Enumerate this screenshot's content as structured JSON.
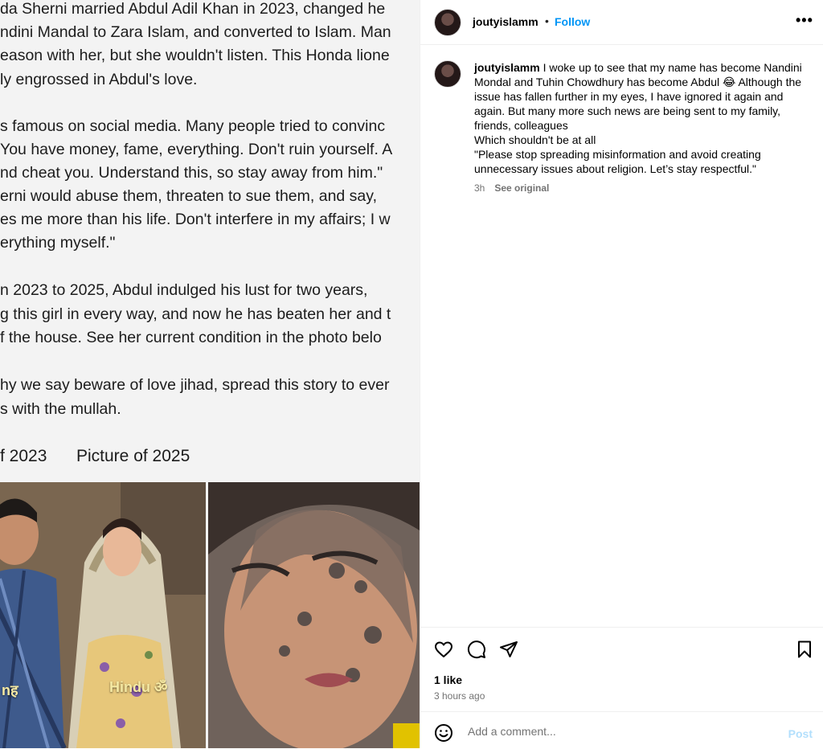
{
  "media": {
    "text_lines": [
      "da Sherni married Abdul Adil Khan in 2023, changed he",
      "ndini Mandal to Zara Islam, and converted to Islam. Man",
      "eason with her, but she wouldn't listen. This Honda lione",
      "ly engrossed in Abdul's love.",
      "s famous on social media. Many people tried to convinc",
      "You have money, fame, everything. Don't ruin yourself. A",
      "nd cheat you. Understand this, so stay away from him.\"",
      "erni would abuse them, threaten to sue them, and say,",
      "es me more than his life. Don't interfere in my affairs; I w",
      "erything myself.\"",
      "n 2023 to 2025, Abdul indulged his lust for two years,",
      "g this girl in every way, and now he has beaten her and t",
      "f the house. See her current condition in the photo belo",
      "hy we say beware of love jihad, spread this story to ever",
      "s with the mullah."
    ],
    "caption_left": "f 2023",
    "caption_right": "Picture of 2025",
    "tag_left": "nह",
    "tag_hindu": "Hindu ॐ"
  },
  "post": {
    "username": "joutyislamm",
    "separator": "•",
    "follow_label": "Follow",
    "more_label": "•••",
    "caption_username": "joutyislamm",
    "caption_text": " I woke up to see that my name has become Nandini Mondal and Tuhin Chowdhury has become Abdul 😂 Although the issue has fallen further in my eyes, I have ignored it again and again. But many more such news are being sent to my family, friends, colleagues\nWhich shouldn't be at all\n\"Please stop spreading misinformation and avoid creating unnecessary issues about religion. Let’s stay respectful.\"",
    "age": "3h",
    "see_original": "See original",
    "likes": "1 like",
    "time_ago": "3 hours ago",
    "comment_placeholder": "Add a comment...",
    "post_label": "Post"
  },
  "icons": {
    "heart": "heart-icon",
    "comment": "comment-icon",
    "share": "share-icon",
    "bookmark": "bookmark-icon",
    "emoji": "emoji-icon"
  },
  "colors": {
    "accent": "#0095f6",
    "post_disabled": "#b2dffc",
    "muted": "#737373"
  }
}
